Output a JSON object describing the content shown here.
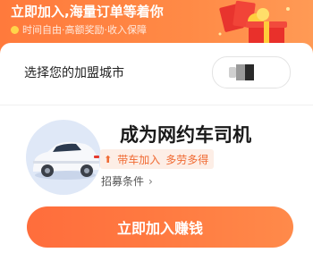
{
  "banner": {
    "title": "立即加入,海量订单等着你",
    "subtitle": "时间自由·高额奖励·收入保障",
    "icons": [
      "coin-icon",
      "gift-box-icon",
      "red-envelope-icon"
    ]
  },
  "city_selector": {
    "label": "选择您的加盟城市",
    "value": ""
  },
  "driver_card": {
    "title": "成为网约车司机",
    "perk_part1": "带车加入",
    "perk_part2": "多劳多得",
    "recruit_link": "招募条件",
    "icons": [
      "car-image",
      "up-arrow-icon",
      "chevron-right-icon"
    ]
  },
  "cta": {
    "label": "立即加入赚钱"
  },
  "colors": {
    "accent": "#ff7a3c",
    "tag_bg": "#fdeee6",
    "tag_text": "#f06a32"
  }
}
